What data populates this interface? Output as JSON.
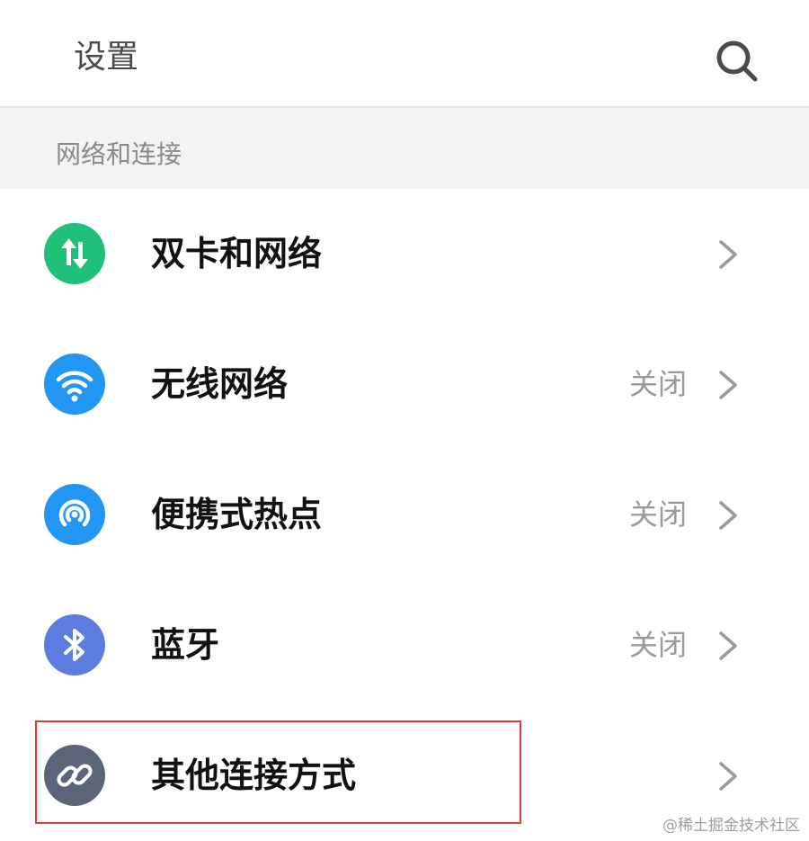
{
  "header": {
    "title": "设置",
    "search_icon": "search-icon"
  },
  "section": {
    "title": "网络和连接"
  },
  "rows": [
    {
      "label": "双卡和网络",
      "value": "",
      "icon": "dual-sim-icon",
      "icon_color": "#1fc07a"
    },
    {
      "label": "无线网络",
      "value": "关闭",
      "icon": "wifi-icon",
      "icon_color": "#2196f3"
    },
    {
      "label": "便携式热点",
      "value": "关闭",
      "icon": "hotspot-icon",
      "icon_color": "#2196f3"
    },
    {
      "label": "蓝牙",
      "value": "关闭",
      "icon": "bluetooth-icon",
      "icon_color": "#5c7ce0"
    },
    {
      "label": "其他连接方式",
      "value": "",
      "icon": "link-icon",
      "icon_color": "#5b6478"
    }
  ],
  "highlight_color": "#e53935",
  "watermark": "@稀土掘金技术社区"
}
